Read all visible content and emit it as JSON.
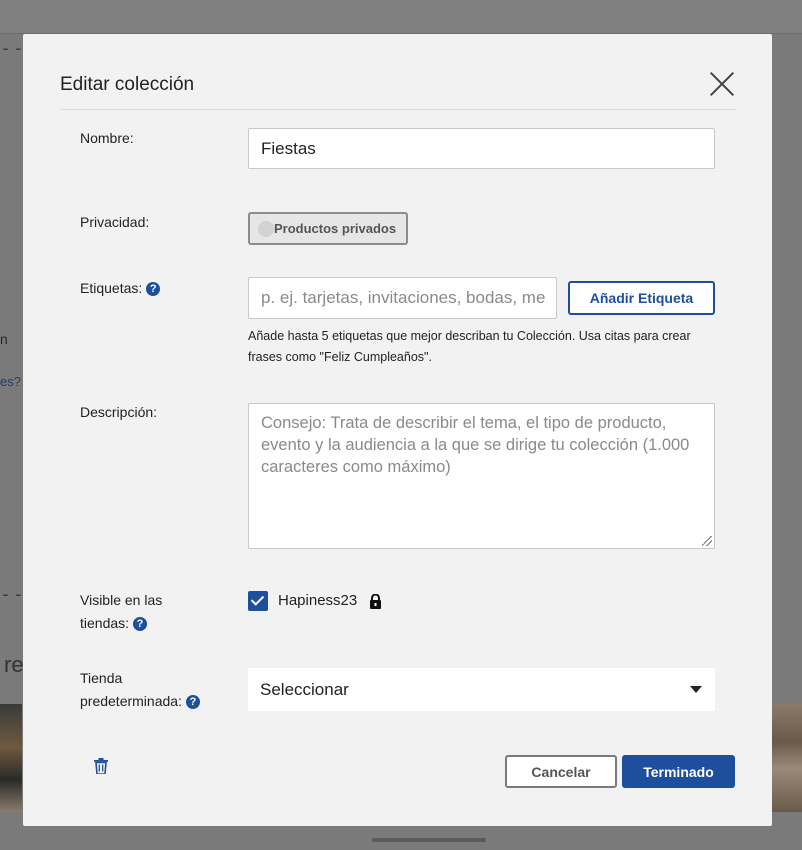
{
  "background": {
    "fragments": {
      "dash_top": "--",
      "text_n": "n",
      "link_es": "es?",
      "dash_mid": "--",
      "big_re": "re"
    }
  },
  "modal": {
    "title": "Editar colección",
    "close_icon": "close-icon",
    "fields": {
      "name": {
        "label": "Nombre:",
        "value": "Fiestas"
      },
      "privacy": {
        "label": "Privacidad:",
        "toggle_label": "Productos privados"
      },
      "tags": {
        "label": "Etiquetas:",
        "placeholder": "p. ej. tarjetas, invitaciones, bodas, me",
        "add_button": "Añadir Etiqueta",
        "hint": "Añade hasta 5 etiquetas que mejor describan tu Colección. Usa citas para crear frases como \"Feliz Cumpleaños\"."
      },
      "description": {
        "label": "Descripción:",
        "placeholder": "Consejo: Trata de describir el tema, el tipo de producto, evento y la audiencia a la que se dirige tu colección (1.000 caracteres como máximo)"
      },
      "visible": {
        "label_line1": "Visible en las",
        "label_line2": "tiendas:",
        "store_name": "Hapiness23",
        "checked": true
      },
      "default_store": {
        "label_line1": "Tienda",
        "label_line2": "predeterminada:",
        "selected": "Seleccionar"
      }
    },
    "help_glyph": "?",
    "footer": {
      "cancel": "Cancelar",
      "done": "Terminado"
    }
  },
  "colors": {
    "accent": "#1e4f9c",
    "overlay": "#7a7a7a",
    "modal_bg": "#f2f2f2"
  }
}
